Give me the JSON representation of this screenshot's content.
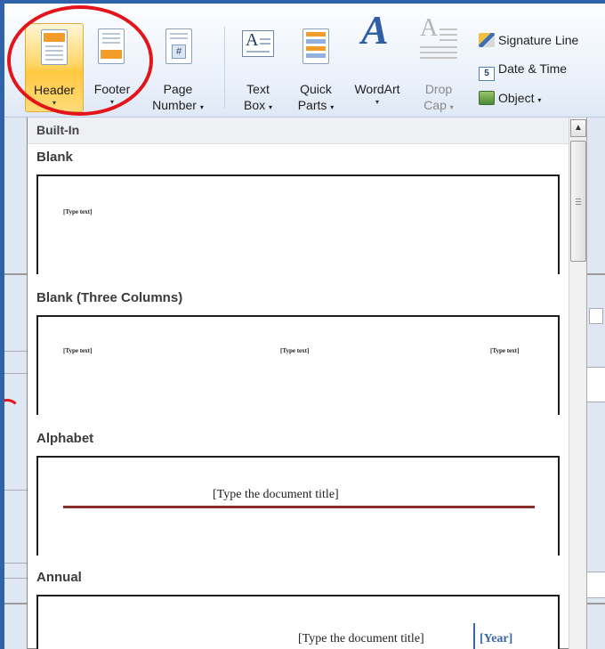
{
  "ribbon": {
    "header": {
      "label": "Header"
    },
    "footer": {
      "label": "Footer"
    },
    "page_number": {
      "line1": "Page",
      "line2": "Number"
    },
    "text_box": {
      "line1": "Text",
      "line2": "Box"
    },
    "quick_parts": {
      "line1": "Quick",
      "line2": "Parts"
    },
    "wordart": {
      "label": "WordArt"
    },
    "drop_cap": {
      "line1": "Drop",
      "line2": "Cap"
    },
    "signature_line": "Signature Line",
    "date_time": "Date & Time",
    "object": "Object",
    "date_icon_text": "5",
    "page_number_icon_text": "#",
    "text_box_icon_text": "A",
    "wordart_icon_text": "A",
    "drop_cap_icon_text": "A",
    "caret": "▾"
  },
  "gallery": {
    "group_label": "Built-In",
    "sections": [
      {
        "title": "Blank",
        "placeholders": [
          "[Type text]"
        ]
      },
      {
        "title": "Blank (Three Columns)",
        "placeholders": [
          "[Type text]",
          "[Type text]",
          "[Type text]"
        ]
      },
      {
        "title": "Alphabet",
        "placeholders": [
          "[Type the document title]"
        ]
      },
      {
        "title": "Annual",
        "placeholders": [
          "[Type the document title]",
          "[Year]"
        ]
      }
    ]
  },
  "scrollbar": {
    "up_arrow": "▲"
  },
  "colors": {
    "annotation_red": "#e4141b",
    "header_highlight": "#ffc840",
    "alphabet_rule": "#8b2d2a",
    "year_blue": "#3b67a6"
  }
}
